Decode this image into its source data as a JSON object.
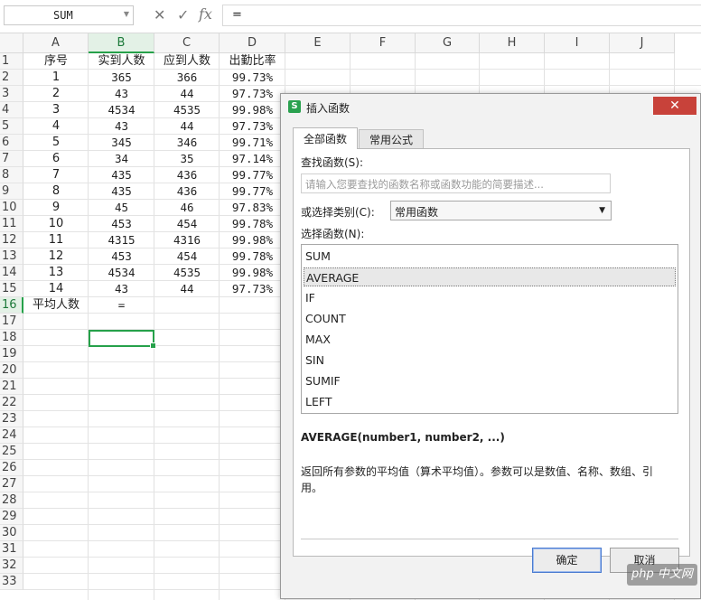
{
  "formula_bar": {
    "name_box": "SUM",
    "cancel_icon": "✕",
    "enter_icon": "✓",
    "fx_label": "fx",
    "formula": "="
  },
  "sheet": {
    "columns": [
      "A",
      "B",
      "C",
      "D",
      "E",
      "F",
      "G",
      "H",
      "I",
      "J"
    ],
    "row_numbers": [
      "1",
      "2",
      "3",
      "4",
      "5",
      "6",
      "7",
      "8",
      "9",
      "10",
      "11",
      "12",
      "13",
      "14",
      "15",
      "16",
      "17",
      "18",
      "19",
      "20",
      "21",
      "22",
      "23",
      "24",
      "25",
      "26",
      "27",
      "28",
      "29",
      "30",
      "31",
      "32",
      "33"
    ],
    "rows": [
      [
        "序号",
        "实到人数",
        "应到人数",
        "出勤比率"
      ],
      [
        "1",
        "365",
        "366",
        "99.73%"
      ],
      [
        "2",
        "43",
        "44",
        "97.73%"
      ],
      [
        "3",
        "4534",
        "4535",
        "99.98%"
      ],
      [
        "4",
        "43",
        "44",
        "97.73%"
      ],
      [
        "5",
        "345",
        "346",
        "99.71%"
      ],
      [
        "6",
        "34",
        "35",
        "97.14%"
      ],
      [
        "7",
        "435",
        "436",
        "99.77%"
      ],
      [
        "8",
        "435",
        "436",
        "99.77%"
      ],
      [
        "9",
        "45",
        "46",
        "97.83%"
      ],
      [
        "10",
        "453",
        "454",
        "99.78%"
      ],
      [
        "11",
        "4315",
        "4316",
        "99.98%"
      ],
      [
        "12",
        "453",
        "454",
        "99.78%"
      ],
      [
        "13",
        "4534",
        "4535",
        "99.98%"
      ],
      [
        "14",
        "43",
        "44",
        "97.73%"
      ],
      [
        "平均人数",
        "=",
        "",
        ""
      ]
    ]
  },
  "dialog": {
    "title": "插入函数",
    "logo": "S",
    "close": "✕",
    "tabs": [
      "全部函数",
      "常用公式"
    ],
    "search_label": "查找函数(S):",
    "search_placeholder": "请输入您要查找的函数名称或函数功能的简要描述...",
    "category_label": "或选择类别(C):",
    "category_value": "常用函数",
    "function_label": "选择函数(N):",
    "functions": [
      "SUM",
      "AVERAGE",
      "IF",
      "COUNT",
      "MAX",
      "SIN",
      "SUMIF",
      "LEFT"
    ],
    "selected_function": "AVERAGE",
    "signature": "AVERAGE(number1, number2, ...)",
    "description": "返回所有参数的平均值（算术平均值）。参数可以是数值、名称、数组、引用。",
    "ok": "确定",
    "cancel": "取消"
  },
  "watermark": "php 中文网"
}
